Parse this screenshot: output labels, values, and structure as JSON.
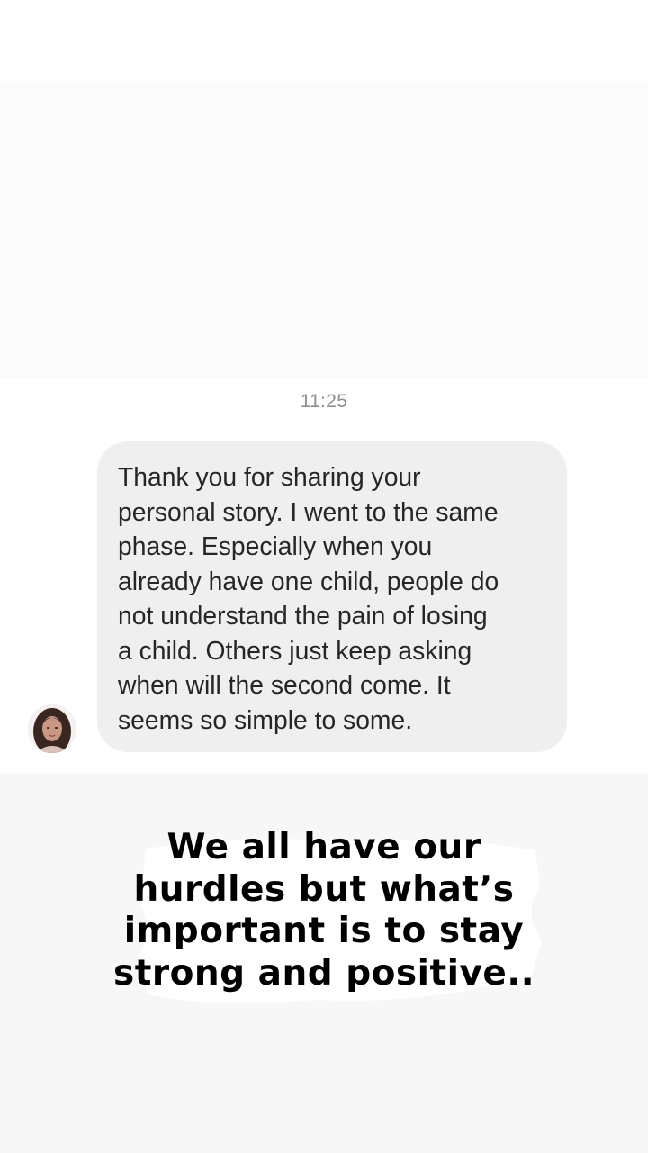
{
  "chat": {
    "timestamp": "11:25",
    "message": {
      "lines": [
        "Thank you for sharing your",
        "personal story. I went to the same",
        "phase. Especially when you",
        "already have one child, people do",
        "not understand the pain of losing",
        "a child. Others just keep asking",
        "when will the second come. It",
        "seems so simple to some."
      ]
    },
    "avatar_icon": "profile-photo"
  },
  "caption": {
    "lines": [
      "We all have our",
      "hurdles but what’s",
      "important is to stay",
      "strong and positive.."
    ]
  },
  "colors": {
    "bubble": "#efefef",
    "message_text": "#262626",
    "timestamp": "#8e8e8e",
    "caption_text": "#000000"
  }
}
